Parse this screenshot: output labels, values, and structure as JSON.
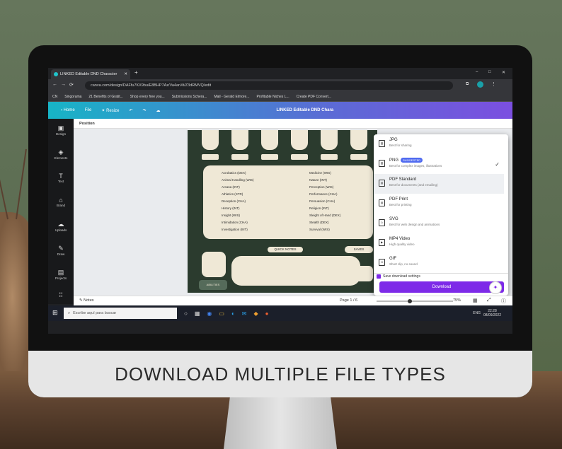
{
  "browser": {
    "tab_title": "LINKED Editable DND Character",
    "new_tab": "+",
    "url": "canva.com/design/DAFfu7KX9bu/E8BHP7Az/Va4anXt/Z3dRMVQ/edit",
    "bookmarks": [
      "CN",
      "Singorama",
      "21 Benefits of Gratit...",
      "Shop every free you...",
      "Submissions Schera...",
      "Mail - Gerald Elmore...",
      "Profitable Niches L...",
      "Create PDF Convert..."
    ],
    "window_controls": [
      "–",
      "□",
      "✕"
    ]
  },
  "canva": {
    "home": "Home",
    "file": "File",
    "resize": "Resize",
    "doc_title": "LINKED Editable DND Chara",
    "position": "Position",
    "sidebar": [
      "Design",
      "Elements",
      "Text",
      "Brand",
      "Uploads",
      "Draw",
      "Projects"
    ],
    "notes": "Notes",
    "page": "Page 1 / 6",
    "zoom": "75%"
  },
  "download_menu": {
    "options": [
      {
        "name": "JPG",
        "desc": "Best for sharing",
        "icon": "image-icon"
      },
      {
        "name": "PNG",
        "desc": "Best for complex images, illustrations",
        "badge": "SUGGESTED",
        "icon": "image-icon",
        "selected": true
      },
      {
        "name": "PDF Standard",
        "desc": "Best for documents (and emailing)",
        "icon": "pdf-icon",
        "highlighted": true
      },
      {
        "name": "PDF Print",
        "desc": "Best for printing",
        "icon": "pdf-icon"
      },
      {
        "name": "SVG",
        "desc": "Best for web design and animations",
        "icon": "svg-icon"
      },
      {
        "name": "MP4 Video",
        "desc": "High quality video",
        "icon": "video-icon"
      },
      {
        "name": "GIF",
        "desc": "Short clip, no sound",
        "icon": "gif-icon"
      }
    ],
    "save_settings": "Save download settings",
    "download_button": "Download"
  },
  "sheet": {
    "skills_left": [
      "Acrobatics (DEX)",
      "Animal Handling (WIS)",
      "Arcana (INT)",
      "Athletics (STR)",
      "Deception (CHA)",
      "History (INT)",
      "Insight (WIS)",
      "Intimidation (CHA)",
      "Investigation (INT)"
    ],
    "skills_right": [
      "Medicine (WIS)",
      "Nature (INT)",
      "Perception (WIS)",
      "Performance (CHA)",
      "Persuasion (CHA)",
      "Religion (INT)",
      "Sleight of Hand (DEX)",
      "Stealth (DEX)",
      "Survival (WIS)"
    ],
    "quick_notes": "QUICK NOTES",
    "save_label": "SAVES",
    "misc_label": "ABILITIES"
  },
  "taskbar": {
    "search_placeholder": "Escribe aquí para buscar",
    "lang": "ENG",
    "time": "22:28",
    "date": "08/09/2022"
  },
  "caption": "DOWNLOAD MULTIPLE FILE TYPES",
  "colors": {
    "wall": "#5f6f55",
    "canva_purple": "#7d2ae8",
    "sheet_green": "#2b3b2e"
  }
}
